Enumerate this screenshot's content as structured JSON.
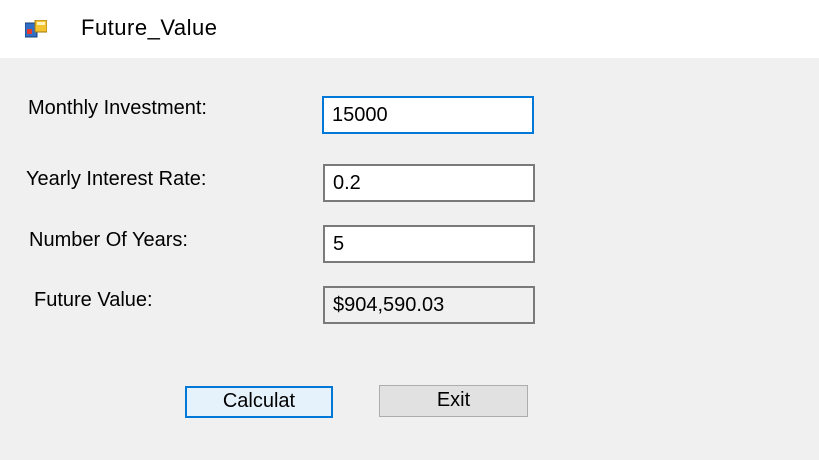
{
  "window": {
    "title": "Future_Value",
    "icon": "winforms-app-icon"
  },
  "form": {
    "monthly_investment": {
      "label": "Monthly Investment:",
      "value": "15000"
    },
    "yearly_interest_rate": {
      "label": "Yearly Interest Rate:",
      "value": "0.2"
    },
    "number_of_years": {
      "label": "Number Of Years:",
      "value": "5"
    },
    "future_value": {
      "label": "Future Value:",
      "value": "$904,590.03"
    }
  },
  "buttons": {
    "calculate_label": "Calculat",
    "exit_label": "Exit"
  },
  "colors": {
    "focus_border": "#0078d7",
    "background": "#f0f0f0"
  }
}
